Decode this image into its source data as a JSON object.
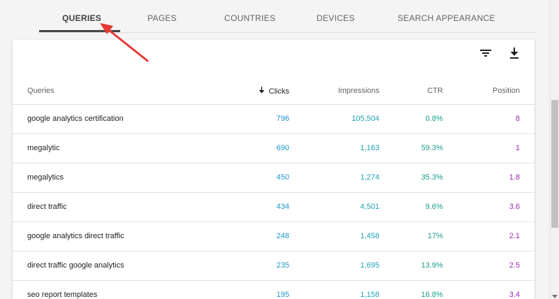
{
  "tabs": [
    {
      "label": "QUERIES",
      "active": true
    },
    {
      "label": "PAGES",
      "active": false
    },
    {
      "label": "COUNTRIES",
      "active": false
    },
    {
      "label": "DEVICES",
      "active": false
    },
    {
      "label": "SEARCH APPEARANCE",
      "active": false
    }
  ],
  "toolbar": {
    "filter_icon": "filter-icon",
    "download_icon": "download-icon"
  },
  "table": {
    "headers": {
      "query": "Queries",
      "clicks": "Clicks",
      "impressions": "Impressions",
      "ctr": "CTR",
      "position": "Position"
    },
    "sorted_by": "Clicks",
    "rows": [
      {
        "query": "google analytics certification",
        "clicks": "796",
        "impressions": "105,504",
        "ctr": "0.8%",
        "position": "8"
      },
      {
        "query": "megalytic",
        "clicks": "690",
        "impressions": "1,163",
        "ctr": "59.3%",
        "position": "1"
      },
      {
        "query": "megalytics",
        "clicks": "450",
        "impressions": "1,274",
        "ctr": "35.3%",
        "position": "1.8"
      },
      {
        "query": "direct traffic",
        "clicks": "434",
        "impressions": "4,501",
        "ctr": "9.6%",
        "position": "3.6"
      },
      {
        "query": "google analytics direct traffic",
        "clicks": "248",
        "impressions": "1,458",
        "ctr": "17%",
        "position": "2.1"
      },
      {
        "query": "direct traffic google analytics",
        "clicks": "235",
        "impressions": "1,695",
        "ctr": "13.9%",
        "position": "2.5"
      },
      {
        "query": "seo report templates",
        "clicks": "195",
        "impressions": "1,158",
        "ctr": "16.8%",
        "position": "3.4"
      }
    ]
  },
  "colors": {
    "clicks": "#2196c9",
    "impressions": "#1fa3b5",
    "ctr": "#1a9c8c",
    "position": "#9c27b0",
    "annotation_arrow": "#e53935"
  }
}
